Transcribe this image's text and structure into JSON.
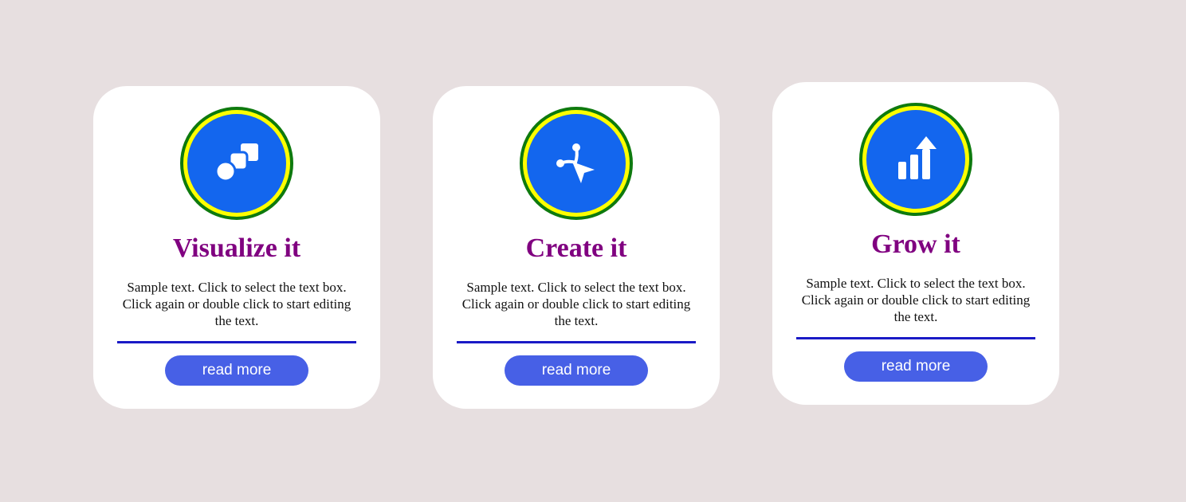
{
  "colors": {
    "page_background": "#e7dfe0",
    "card_background": "#ffffff",
    "title": "#800080",
    "icon_fill": "#1366ee",
    "icon_ring": "#ffff00",
    "icon_ring_border": "#0e7a0e",
    "divider": "#1a1ac6",
    "button": "#4760e6",
    "button_text": "#ffffff"
  },
  "cards": [
    {
      "icon": "shapes-icon",
      "title": "Visualize it",
      "text": "Sample text. Click to select the text box. Click again or double click to start editing the text.",
      "button_label": "read more"
    },
    {
      "icon": "vector-node-cursor-icon",
      "title": "Create it",
      "text": "Sample text. Click to select the text box. Click again or double click to start editing the text.",
      "button_label": "read more"
    },
    {
      "icon": "growth-bar-chart-icon",
      "title": "Grow it",
      "text": "Sample text. Click to select the text box. Click again or double click to start editing the text.",
      "button_label": "read more"
    }
  ]
}
